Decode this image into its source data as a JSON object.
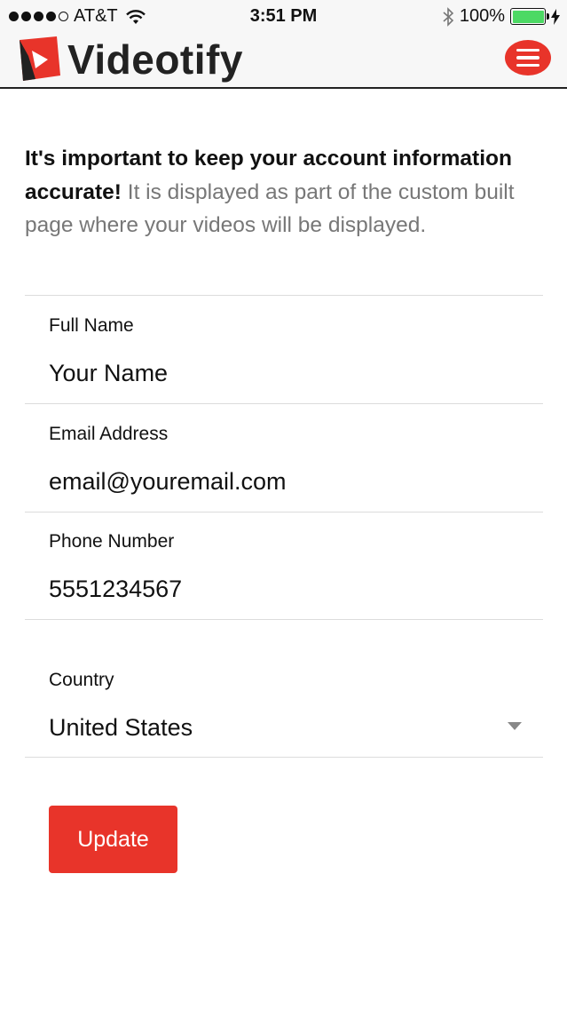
{
  "status_bar": {
    "carrier": "AT&T",
    "time": "3:51 PM",
    "battery": "100%",
    "battery_level": 1.0,
    "signal_bars": 4,
    "signal_max": 5
  },
  "header": {
    "brand": "Videotify",
    "menu_icon": "hamburger-icon",
    "accent_color": "#e8342a"
  },
  "intro": {
    "bold_text": "It's important to keep your account information accurate!",
    "text": " It is displayed as part of the custom built page where your videos will be displayed."
  },
  "form": {
    "full_name": {
      "label": "Full Name",
      "value": "Your Name"
    },
    "email": {
      "label": "Email Address",
      "value": "email@youremail.com"
    },
    "phone": {
      "label": "Phone Number",
      "value": "5551234567"
    },
    "country": {
      "label": "Country",
      "value": "United States"
    },
    "submit_label": "Update"
  }
}
